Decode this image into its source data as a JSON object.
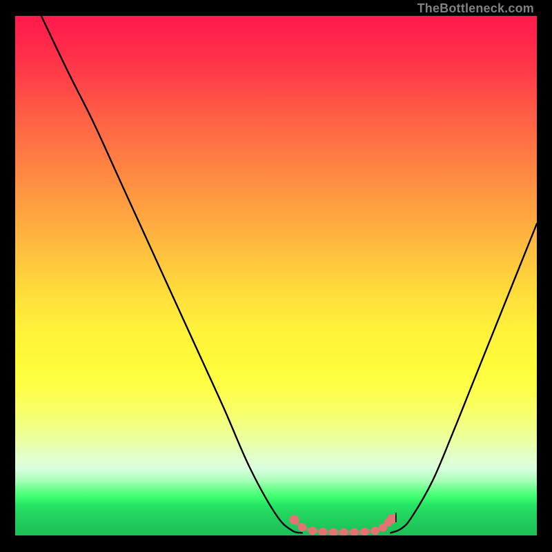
{
  "attribution": "TheBottleneck.com",
  "colors": {
    "frame": "#000000",
    "curve": "#000000",
    "marker": "#e57373",
    "attribution": "#808080"
  },
  "chart_data": {
    "type": "line",
    "title": "",
    "xlabel": "",
    "ylabel": "",
    "xlim": [
      0,
      100
    ],
    "ylim": [
      0,
      100
    ],
    "grid": false,
    "series": [
      {
        "name": "left-curve",
        "x": [
          5,
          10,
          15,
          20,
          25,
          30,
          35,
          40,
          45,
          50,
          53,
          55
        ],
        "values": [
          100,
          89.5,
          79.5,
          68.5,
          57.5,
          46.5,
          35.5,
          24.5,
          13,
          4,
          1,
          0.5
        ]
      },
      {
        "name": "right-curve",
        "x": [
          72,
          74,
          76,
          80,
          84,
          88,
          92,
          96,
          100
        ],
        "values": [
          0.5,
          1.3,
          3.5,
          10.5,
          20,
          30,
          40,
          50,
          60
        ]
      }
    ],
    "highlight_segment": {
      "name": "valley-highlight",
      "x": [
        53.5,
        55,
        57,
        59,
        61,
        63,
        65,
        67,
        69,
        70.5,
        71.5,
        72.2
      ],
      "values": [
        3.0,
        1.6,
        0.9,
        0.7,
        0.6,
        0.6,
        0.6,
        0.7,
        0.9,
        1.5,
        2.5,
        3.2
      ]
    }
  }
}
